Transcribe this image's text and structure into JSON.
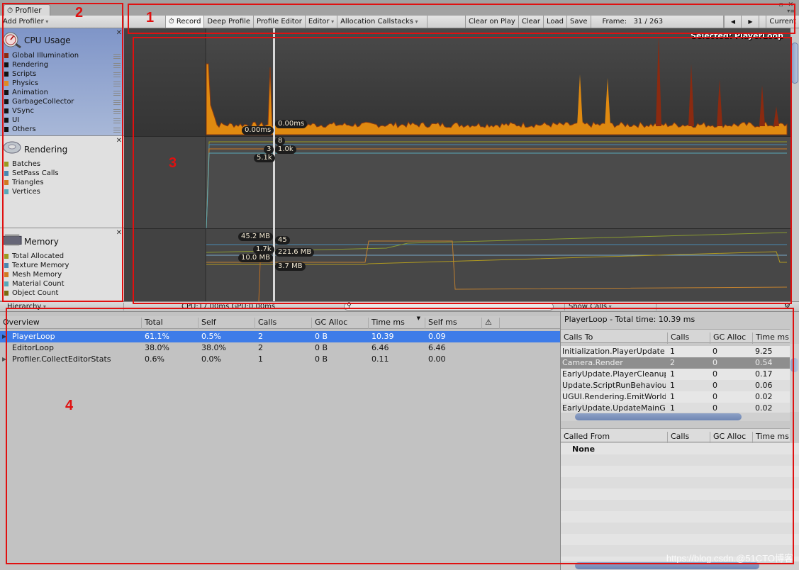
{
  "window": {
    "tab_label": "Profiler",
    "tab_icon": "stopwatch-icon",
    "controls": "▫ ✕",
    "menu_icon": "▾≡"
  },
  "toolbar": {
    "add_profiler": "Add Profiler",
    "record": "Record",
    "deep_profile": "Deep Profile",
    "profile_editor": "Profile Editor",
    "target": "Editor",
    "allocation_callstacks": "Allocation Callstacks",
    "clear_on_play": "Clear on Play",
    "clear": "Clear",
    "load": "Load",
    "save": "Save",
    "frame_label": "Frame:",
    "frame_value": "31 / 263",
    "prev": "◀",
    "next": "▶",
    "current": "Current"
  },
  "sidebar": {
    "cpu": {
      "title": "CPU Usage",
      "items": [
        {
          "label": "Global Illumination",
          "color": "#8b2a10"
        },
        {
          "label": "Rendering",
          "color": "#111111"
        },
        {
          "label": "Scripts",
          "color": "#111111"
        },
        {
          "label": "Physics",
          "color": "#e08a20"
        },
        {
          "label": "Animation",
          "color": "#111111"
        },
        {
          "label": "GarbageCollector",
          "color": "#111111"
        },
        {
          "label": "VSync",
          "color": "#111111"
        },
        {
          "label": "UI",
          "color": "#111111"
        },
        {
          "label": "Others",
          "color": "#111111"
        }
      ]
    },
    "rendering": {
      "title": "Rendering",
      "items": [
        {
          "label": "Batches",
          "color": "#9a9a20"
        },
        {
          "label": "SetPass Calls",
          "color": "#4a88b0"
        },
        {
          "label": "Triangles",
          "color": "#d07a20"
        },
        {
          "label": "Vertices",
          "color": "#58a8b8"
        }
      ]
    },
    "memory": {
      "title": "Memory",
      "items": [
        {
          "label": "Total Allocated",
          "color": "#9a9a20"
        },
        {
          "label": "Texture Memory",
          "color": "#4a88b0"
        },
        {
          "label": "Mesh Memory",
          "color": "#d07a20"
        },
        {
          "label": "Material Count",
          "color": "#58a8b8"
        },
        {
          "label": "Object Count",
          "color": "#7a6a10"
        }
      ]
    }
  },
  "charts": {
    "selected_label": "Selected: PlayerLoop",
    "cpu_labels": [
      "0.00ms",
      "0.00ms"
    ],
    "rendering_labels": [
      "8",
      "3",
      "1.0k",
      "5.1k"
    ],
    "memory_labels": [
      "45.2 MB",
      "45",
      "1.7k",
      "221.6 MB",
      "10.0 MB",
      "3.7 MB"
    ],
    "colors": {
      "cpu_fill": "#e08a10",
      "cpu_spike": "#8b2a10",
      "cursor": "#d8d8d8"
    }
  },
  "status": {
    "view_mode": "Hierarchy",
    "cpu_gpu": "CPU:17.00ms   GPU:0.00ms",
    "search_placeholder": "",
    "show_calls": "Show Calls"
  },
  "hierarchy": {
    "columns": [
      "Overview",
      "Total",
      "Self",
      "Calls",
      "GC Alloc",
      "Time ms",
      "Self ms"
    ],
    "warning_icon": "⚠",
    "rows": [
      {
        "name": "PlayerLoop",
        "total": "61.1%",
        "self": "0.5%",
        "calls": "2",
        "gc": "0 B",
        "time": "10.39",
        "self_ms": "0.09",
        "expandable": true,
        "selected": true
      },
      {
        "name": "EditorLoop",
        "total": "38.0%",
        "self": "38.0%",
        "calls": "2",
        "gc": "0 B",
        "time": "6.46",
        "self_ms": "6.46",
        "expandable": false,
        "selected": false
      },
      {
        "name": "Profiler.CollectEditorStats",
        "total": "0.6%",
        "self": "0.0%",
        "calls": "1",
        "gc": "0 B",
        "time": "0.11",
        "self_ms": "0.00",
        "expandable": true,
        "selected": false
      }
    ]
  },
  "details": {
    "title": "PlayerLoop - Total time: 10.39 ms",
    "calls_to_columns": [
      "Calls To",
      "Calls",
      "GC Alloc",
      "Time ms"
    ],
    "calls_to": [
      {
        "name": "Initialization.PlayerUpdate",
        "calls": "1",
        "gc": "0",
        "time": "9.25"
      },
      {
        "name": "Camera.Render",
        "calls": "2",
        "gc": "0",
        "time": "0.54"
      },
      {
        "name": "EarlyUpdate.PlayerCleanup",
        "calls": "1",
        "gc": "0",
        "time": "0.17"
      },
      {
        "name": "Update.ScriptRunBehaviour",
        "calls": "1",
        "gc": "0",
        "time": "0.06"
      },
      {
        "name": "UGUI.Rendering.EmitWorld",
        "calls": "1",
        "gc": "0",
        "time": "0.02"
      },
      {
        "name": "EarlyUpdate.UpdateMainGame",
        "calls": "1",
        "gc": "0",
        "time": "0.02"
      }
    ],
    "called_from_columns": [
      "Called From",
      "Calls",
      "GC Alloc",
      "Time ms"
    ],
    "called_from": [
      {
        "name": "None"
      }
    ]
  },
  "annotations": [
    "1",
    "2",
    "3",
    "4"
  ],
  "watermark": "https://blog.csdn.@51CTO博客"
}
